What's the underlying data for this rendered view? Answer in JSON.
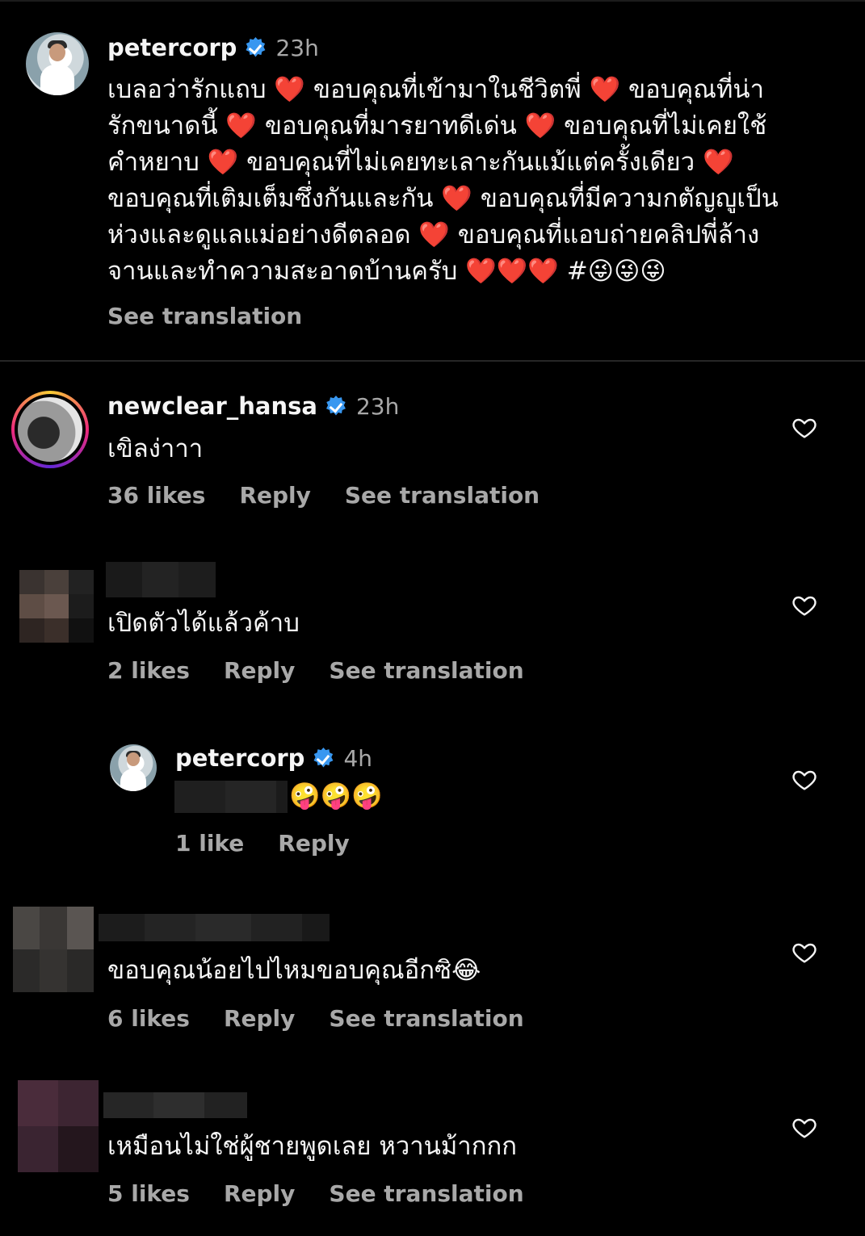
{
  "caption": {
    "username": "petercorp",
    "time": "23h",
    "lines": [
      "เบลอว่ารักแถบ ❤️ ขอบคุณที่เข้ามาในชีวิตพี่ ❤️ ขอบคุณที่น่า",
      "รักขนาดนี้ ❤️ ขอบคุณที่มารยาทดีเด่น ❤️ ขอบคุณที่ไม่เคยใช้",
      "คำหยาบ ❤️ ขอบคุณที่ไม่เคยทะเลาะกันแม้แต่ครั้งเดียว ❤️",
      "ขอบคุณที่เติมเต็มซึ่งกันและกัน ❤️ ขอบคุณที่มีความกตัญญูเป็น",
      "ห่วงและดูแลแม่อย่างดีตลอด ❤️ ขอบคุณที่แอบถ่ายคลิปพี่ล้าง",
      "จานและทำความสะอาดบ้านครับ ❤️❤️❤️ #😜😜😜"
    ],
    "see_translation": "See translation"
  },
  "comments": [
    {
      "username": "newclear_hansa",
      "time": "23h",
      "text": "เขิลง่าาา",
      "likes": "36 likes",
      "reply": "Reply",
      "see_translation": "See translation"
    },
    {
      "text": "เปิดตัวได้แล้วค้าบ",
      "likes": "2 likes",
      "reply": "Reply",
      "see_translation": "See translation"
    },
    {
      "username": "petercorp",
      "time": "4h",
      "text": "🤪🤪🤪",
      "likes": "1 like",
      "reply": "Reply"
    },
    {
      "text": "ขอบคุณน้อยไปไหมขอบคุณอีกซิ😂",
      "likes": "6 likes",
      "reply": "Reply",
      "see_translation": "See translation"
    },
    {
      "text": "เหมือนไม่ใช่ผู้ชายพูดเลย หวานม้ากกก",
      "likes": "5 likes",
      "reply": "Reply",
      "see_translation": "See translation"
    }
  ],
  "colors": {
    "background": "#000000",
    "primary_text": "#f5f5f5",
    "secondary_text": "#a8a8a8",
    "verified": "#3897f0"
  },
  "icons": [
    "verified-badge-icon",
    "heart-icon"
  ]
}
